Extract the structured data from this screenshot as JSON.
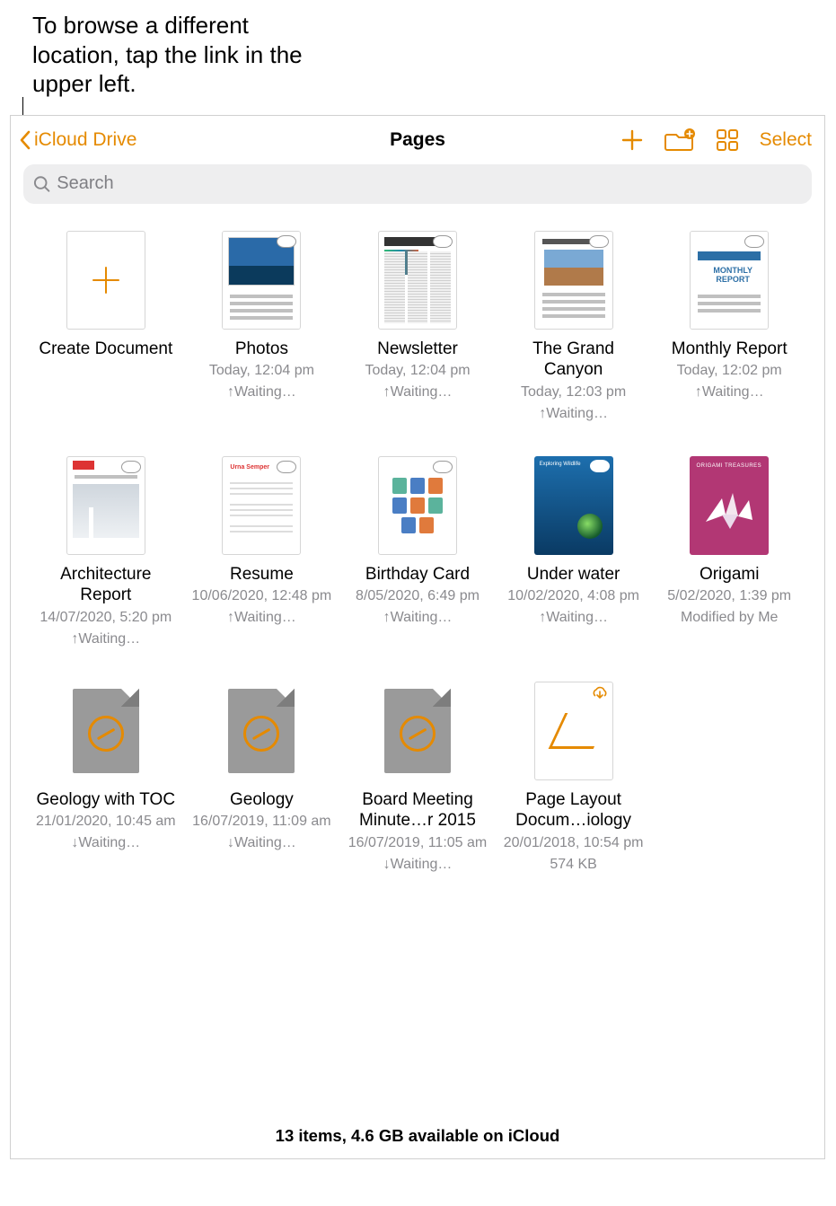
{
  "callout": "To browse a different location, tap the link in the upper left.",
  "toolbar": {
    "back_label": "iCloud Drive",
    "title": "Pages",
    "select_label": "Select"
  },
  "search": {
    "placeholder": "Search"
  },
  "documents": {
    "create": {
      "title": "Create Document"
    },
    "photos": {
      "title": "Photos",
      "date": "Today, 12:04 pm",
      "status": "Waiting…"
    },
    "newsletter": {
      "title": "Newsletter",
      "date": "Today, 12:04 pm",
      "status": "Waiting…"
    },
    "canyon": {
      "title": "The Grand Canyon",
      "date": "Today, 12:03 pm",
      "status": "Waiting…"
    },
    "monthly": {
      "title": "Monthly Report",
      "date": "Today, 12:02 pm",
      "status": "Waiting…",
      "thumb_text": "MONTHLY REPORT"
    },
    "arch": {
      "title": "Architecture Report",
      "date": "14/07/2020, 5:20 pm",
      "status": "Waiting…"
    },
    "resume": {
      "title": "Resume",
      "date": "10/06/2020, 12:48 pm",
      "status": "Waiting…",
      "thumb_name": "Urna Semper"
    },
    "bday": {
      "title": "Birthday Card",
      "date": "8/05/2020, 6:49 pm",
      "status": "Waiting…"
    },
    "water": {
      "title": "Under water",
      "date": "10/02/2020, 4:08 pm",
      "status": "Waiting…",
      "thumb_text": "Exploring Wildlife"
    },
    "origami": {
      "title": "Origami",
      "date": "5/02/2020, 1:39 pm",
      "status": "Modified by Me",
      "thumb_text": "ORIGAMI TREASURES"
    },
    "geo_toc": {
      "title": "Geology with TOC",
      "date": "21/01/2020, 10:45 am",
      "status": "Waiting…"
    },
    "geo": {
      "title": "Geology",
      "date": "16/07/2019, 11:09 am",
      "status": "Waiting…"
    },
    "board": {
      "title": "Board Meeting Minute…r 2015",
      "date": "16/07/2019, 11:05 am",
      "status": "Waiting…"
    },
    "pagelayout": {
      "title": "Page Layout Docum…iology",
      "date": "20/01/2018, 10:54 pm",
      "status": "574 KB"
    }
  },
  "footer": {
    "status": "13 items, 4.6 GB available on iCloud"
  },
  "colors": {
    "accent": "#e58a00",
    "secondary_text": "#8a8a8e",
    "search_bg": "#eeeeef"
  }
}
